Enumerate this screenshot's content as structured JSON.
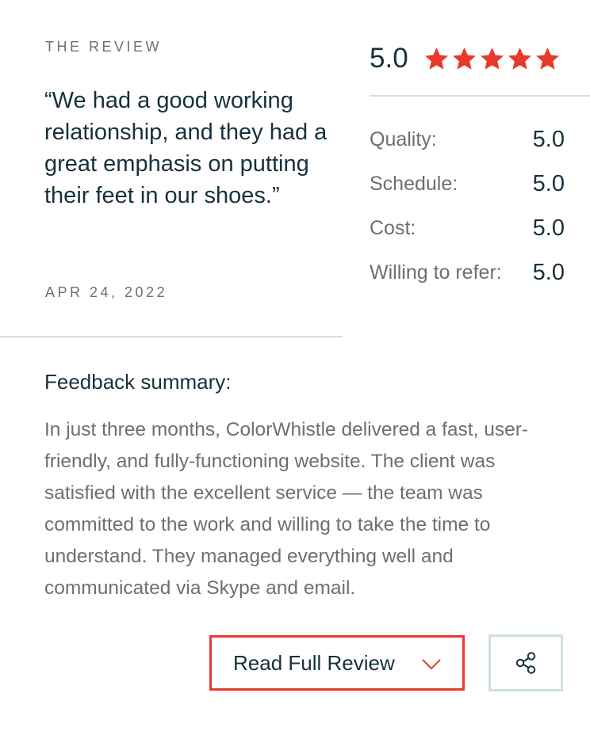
{
  "review": {
    "section_label": "THE REVIEW",
    "quote": "“We had a good working relationship, and they had a great emphasis on putting their feet in our shoes.”",
    "date": "APR 24, 2022"
  },
  "overall": {
    "score": "5.0",
    "stars": 5,
    "star_color": "#e8392c"
  },
  "ratings": [
    {
      "name": "Quality:",
      "value": "5.0"
    },
    {
      "name": "Schedule:",
      "value": "5.0"
    },
    {
      "name": "Cost:",
      "value": "5.0"
    },
    {
      "name": "Willing to refer:",
      "value": "5.0"
    }
  ],
  "feedback": {
    "title": "Feedback summary:",
    "body": "In just three months, ColorWhistle delivered a fast, user-friendly, and fully-functioning website. The client was satisfied with the excellent service — the team was committed to the work and willing to take the time to understand. They managed everything well and communicated via Skype and email."
  },
  "actions": {
    "read_full_review_label": "Read Full Review",
    "read_full_review_icon": "chevron-down-icon",
    "share_icon": "share-icon",
    "highlight_color": "#e8392c"
  },
  "colors": {
    "text_dark": "#17313b",
    "text_muted": "#6a7073",
    "divider": "#cfe0e3"
  }
}
